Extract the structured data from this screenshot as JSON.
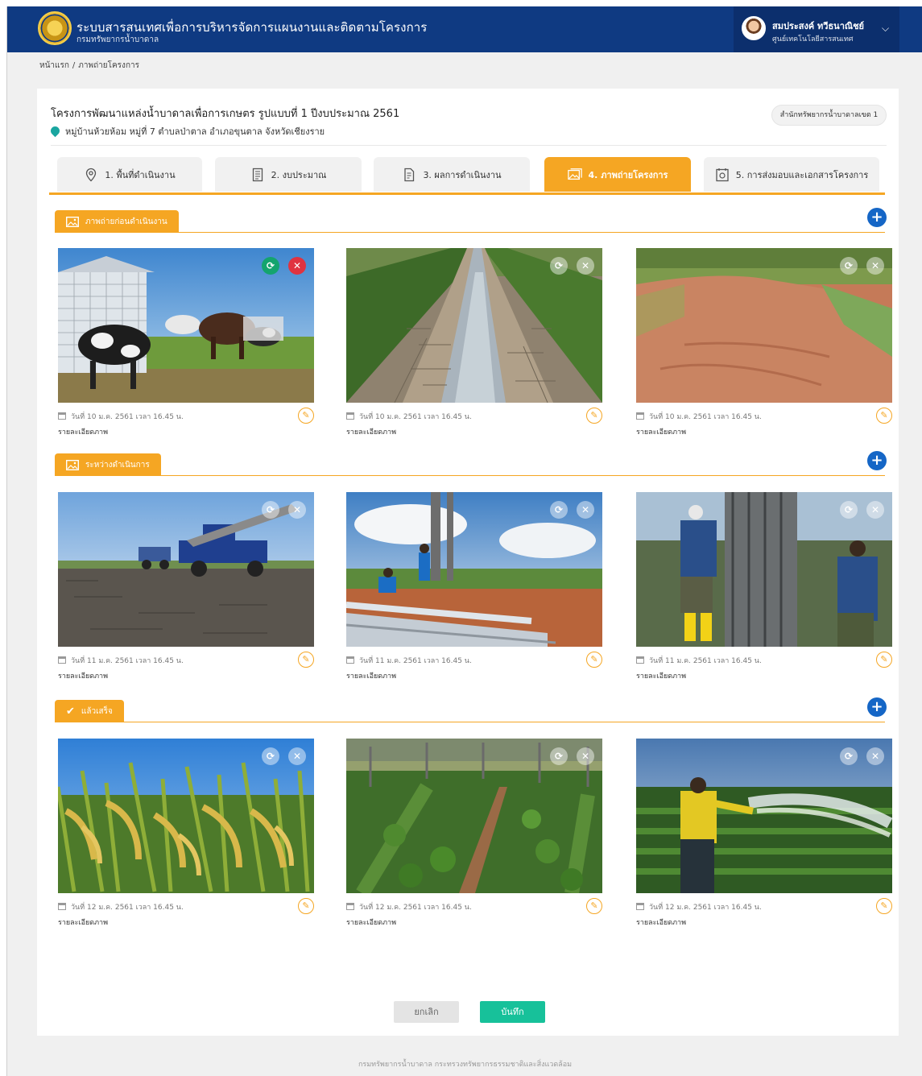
{
  "header": {
    "app_title": "ระบบสารสนเทศเพื่อการบริหารจัดการแผนงานและติดตามโครงการ",
    "app_subtitle": "กรมทรัพยากรน้ำบาดาล",
    "user_name": "สมประสงค์  ทวีธนาณิชย์",
    "user_org": "ศูนย์เทคโนโลยีสารสนเทศ",
    "caret": "⌵"
  },
  "breadcrumb": {
    "home": "หน้าแรก",
    "sep": "/",
    "current": "ภาพถ่ายโครงการ"
  },
  "project": {
    "title": "โครงการพัฒนาแหล่งน้ำบาดาลเพื่อการเกษตร รูปแบบที่ 1  ปีงบประมาณ  2561",
    "location": "หมู่บ้านห้วยห้อม หมู่ที่ 7  ตำบลป่าตาล  อำเภอขุนตาล  จังหวัดเชียงราย",
    "org_badge": "สำนักทรัพยากรน้ำบาดาลเขต 1"
  },
  "tabs": [
    {
      "label": "1. พื้นที่ดำเนินงาน",
      "icon": "map-pin-icon"
    },
    {
      "label": "2. งบประมาณ",
      "icon": "document-icon"
    },
    {
      "label": "3. ผลการดำเนินงาน",
      "icon": "report-icon"
    },
    {
      "label": "4. ภาพถ่ายโครงการ",
      "icon": "images-icon",
      "active": true
    },
    {
      "label": "5. การส่งมอบและเอกสารโครงการ",
      "icon": "handover-icon"
    }
  ],
  "sections": [
    {
      "label": "ภาพถ่ายก่อนดำเนินงาน",
      "photos": [
        {
          "date": "วันที่  10  ม.ค. 2561  เวลา 16.45 น.",
          "caption": "รายละเอียดภาพ",
          "scene": "cows"
        },
        {
          "date": "วันที่  10  ม.ค. 2561  เวลา 16.45 น.",
          "caption": "รายละเอียดภาพ",
          "scene": "canal"
        },
        {
          "date": "วันที่  10  ม.ค. 2561  เวลา 16.45 น.",
          "caption": "รายละเอียดภาพ",
          "scene": "dirt-road"
        }
      ]
    },
    {
      "label": "ระหว่างดำเนินการ",
      "photos": [
        {
          "date": "วันที่  11  ม.ค. 2561  เวลา 16.45 น.",
          "caption": "รายละเอียดภาพ",
          "scene": "drill-truck"
        },
        {
          "date": "วันที่  11  ม.ค. 2561  เวลา 16.45 น.",
          "caption": "รายละเอียดภาพ",
          "scene": "pipes"
        },
        {
          "date": "วันที่  11  ม.ค. 2561  เวลา 16.45 น.",
          "caption": "รายละเอียดภาพ",
          "scene": "workers"
        }
      ]
    },
    {
      "label": "แล้วเสร็จ",
      "photos": [
        {
          "date": "วันที่  12  ม.ค. 2561  เวลา 16.45 น.",
          "caption": "รายละเอียดภาพ",
          "scene": "rice"
        },
        {
          "date": "วันที่  12  ม.ค. 2561  เวลา 16.45 น.",
          "caption": "รายละเอียดภาพ",
          "scene": "vegetables"
        },
        {
          "date": "วันที่  12  ม.ค. 2561  เวลา 16.45 น.",
          "caption": "รายละเอียดภาพ",
          "scene": "watering"
        }
      ]
    }
  ],
  "buttons": {
    "cancel": "ยกเลิก",
    "save": "บันทึก"
  },
  "footer": "กรมทรัพยากรน้ำบาดาล  กระทรวงทรัพยากรธรรมชาติและสิ่งแวดล้อม",
  "colors": {
    "header": "#0f3a82",
    "accent": "#f5a623",
    "save": "#17c19a",
    "add": "#1566c6",
    "delete": "#e03340",
    "refresh": "#14a46e"
  }
}
